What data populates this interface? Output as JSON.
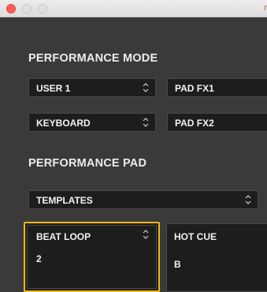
{
  "titlebar": {
    "title_fragment": "r"
  },
  "performance_mode": {
    "title": "PERFORMANCE MODE",
    "row1": {
      "left": "USER 1",
      "right": "PAD FX1"
    },
    "row2": {
      "left": "KEYBOARD",
      "right": "PAD FX2"
    }
  },
  "performance_pad": {
    "title": "PERFORMANCE PAD",
    "templates": "TEMPLATES",
    "pads": [
      {
        "label": "BEAT LOOP",
        "value": "2",
        "selected": true
      },
      {
        "label": "HOT CUE",
        "value": "B",
        "selected": false
      }
    ]
  },
  "colors": {
    "accent": "#f2b90f",
    "background": "#3a3a3a",
    "control": "#1d1d1d"
  }
}
